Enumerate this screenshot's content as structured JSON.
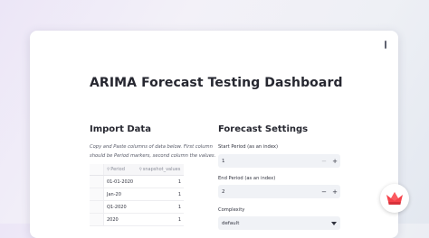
{
  "app": {
    "title": "ARIMA Forecast Testing Dashboard"
  },
  "import_data": {
    "heading": "Import Data",
    "instructions": "Copy and Paste columns of data below. First column should be Period markers, second column the values.",
    "table": {
      "columns": [
        "Period",
        "snapshot_values"
      ],
      "rows": [
        {
          "period": "01-01-2020",
          "value": "1"
        },
        {
          "period": "Jan-20",
          "value": "1"
        },
        {
          "period": "Q1-2020",
          "value": "1"
        },
        {
          "period": "2020",
          "value": "1"
        }
      ]
    }
  },
  "forecast_settings": {
    "heading": "Forecast Settings",
    "start_period": {
      "label": "Start Period (as an index)",
      "value": "1",
      "minus": "−",
      "plus": "+"
    },
    "end_period": {
      "label": "End Period (as an index)",
      "value": "2",
      "minus": "−",
      "plus": "+"
    },
    "complexity": {
      "label": "Complexity",
      "value": "default"
    }
  },
  "icons": {
    "menu": "kebab-menu-icon",
    "badge": "crown-icon",
    "column": "column-type-icon",
    "chevron": "chevron-down-icon"
  },
  "colors": {
    "badge_red": "#f5424a",
    "input_bg": "#f0f2f6"
  }
}
